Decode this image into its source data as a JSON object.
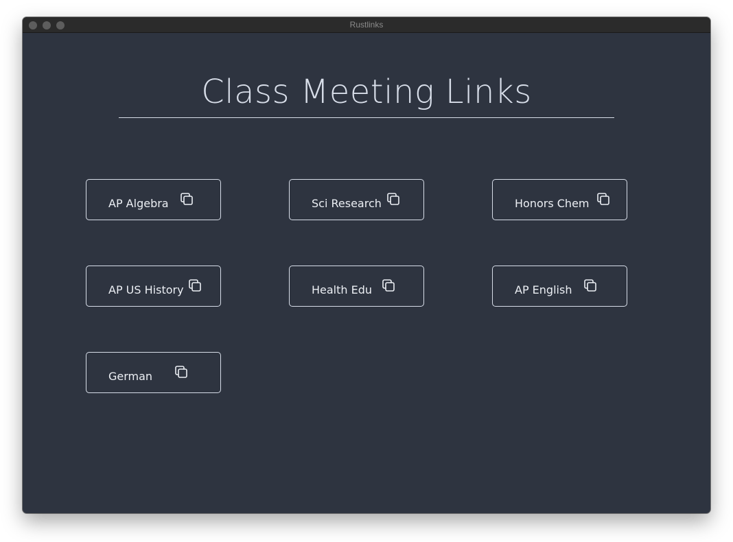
{
  "window": {
    "title": "Rustlinks"
  },
  "page": {
    "heading": "Class Meeting Links"
  },
  "links": [
    {
      "label": "AP Algebra",
      "icon": "copy-icon"
    },
    {
      "label": "Sci Research",
      "icon": "copy-icon"
    },
    {
      "label": "Honors Chem",
      "icon": "copy-icon"
    },
    {
      "label": "AP US History",
      "icon": "copy-icon"
    },
    {
      "label": "Health Edu",
      "icon": "copy-icon"
    },
    {
      "label": "AP English",
      "icon": "copy-icon"
    },
    {
      "label": "German",
      "icon": "copy-icon"
    }
  ],
  "colors": {
    "background": "#2e3440",
    "foreground": "#d8dee9",
    "text": "#eceff4"
  }
}
